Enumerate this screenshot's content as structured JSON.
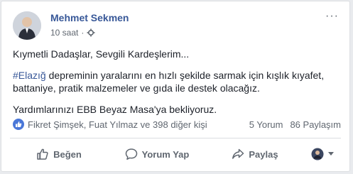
{
  "post": {
    "author": "Mehmet Sekmen",
    "time": "10 saat",
    "audience_icon": "gear-icon",
    "menu_label": "···",
    "body": {
      "greeting": "Kıymetli Dadaşlar, Sevgili Kardeşlerim...",
      "hashtag": "#Elazığ",
      "paragraph": " depreminin yaralarını en hızlı şekilde sarmak için kışlık kıyafet, battaniye, pratik malzemeler ve gıda ile destek olacağız.",
      "closing": "Yardımlarınızı EBB Beyaz Masa'ya bekliyoruz."
    },
    "reactions": {
      "summary": "Fikret Şimşek, Fuat Yılmaz ve 398 diğer kişi"
    },
    "comments": "5 Yorum",
    "shares": "86 Paylaşım",
    "actions": {
      "like": "Beğen",
      "comment": "Yorum Yap",
      "share": "Paylaş"
    }
  },
  "colors": {
    "link": "#385898",
    "text": "#1d2129",
    "meta": "#606770",
    "like_blue": "#4a77d8"
  }
}
